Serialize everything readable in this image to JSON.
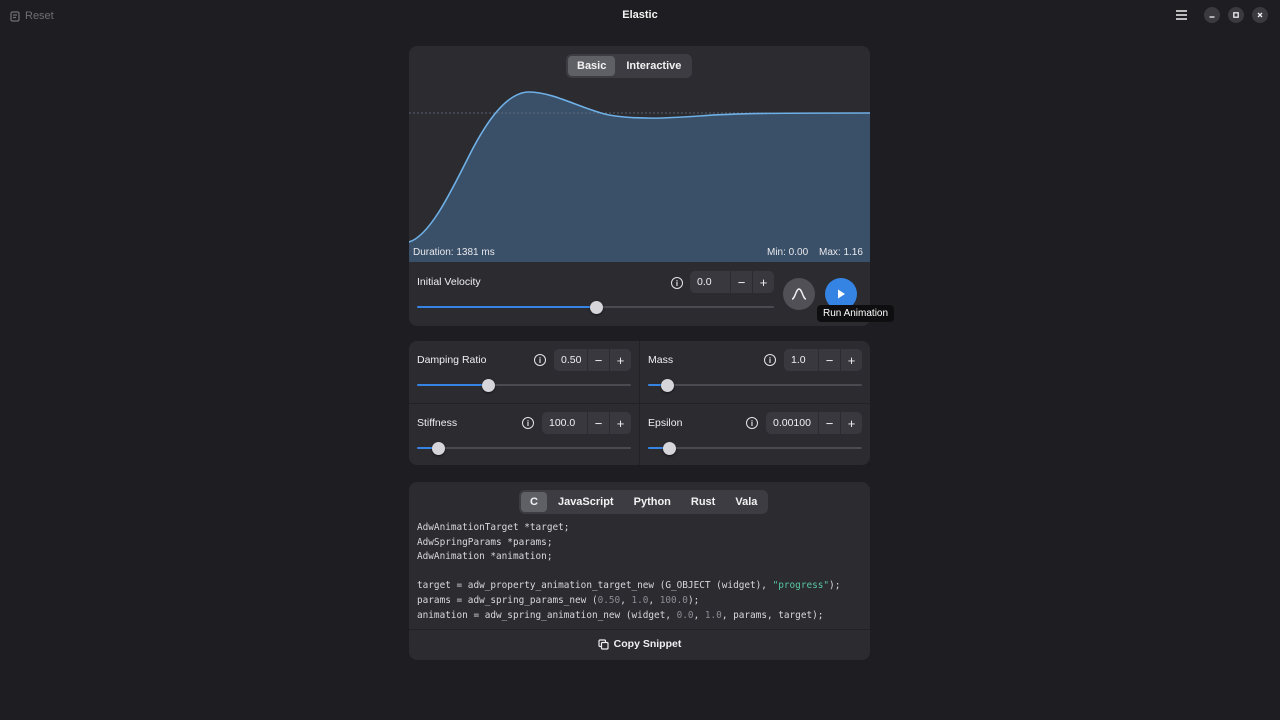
{
  "header": {
    "reset_label": "Reset",
    "title": "Elastic"
  },
  "graph": {
    "tabs": [
      "Basic",
      "Interactive"
    ],
    "active_tab": "Basic",
    "duration_text": "Duration: 1381 ms",
    "min_text": "Min: 0.00",
    "max_text": "Max: 1.16",
    "fill_color": "#3a4f68",
    "line_color": "#6fb0e6"
  },
  "velocity": {
    "label": "Initial Velocity",
    "value": "0.0",
    "slider_fraction": 0.5
  },
  "run_animation_tooltip": "Run Animation",
  "params": {
    "damping": {
      "label": "Damping Ratio",
      "value": "0.50",
      "slider_fraction": 0.33
    },
    "mass": {
      "label": "Mass",
      "value": "1.0",
      "slider_fraction": 0.09
    },
    "stiffness": {
      "label": "Stiffness",
      "value": "100.0",
      "slider_fraction": 0.1
    },
    "epsilon": {
      "label": "Epsilon",
      "value": "0.00100",
      "slider_fraction": 0.1
    }
  },
  "code": {
    "tabs": [
      "C",
      "JavaScript",
      "Python",
      "Rust",
      "Vala"
    ],
    "active_tab": "C",
    "line1": "AdwAnimationTarget *target;",
    "line2": "AdwSpringParams *params;",
    "line3": "AdwAnimation *animation;",
    "line4_a": "target = adw_property_animation_target_new (G_OBJECT (widget), ",
    "line4_str": "\"progress\"",
    "line4_b": ");",
    "line5_a": "params = adw_spring_params_new (",
    "line5_n1": "0.50",
    "line5_n2": "1.0",
    "line5_n3": "100.0",
    "line5_b": ");",
    "line6_a": "animation = adw_spring_animation_new (widget, ",
    "line6_n1": "0.0",
    "line6_n2": "1.0",
    "line6_b": ", params, target);",
    "copy_label": "Copy Snippet"
  },
  "accent_color": "#3584e4"
}
